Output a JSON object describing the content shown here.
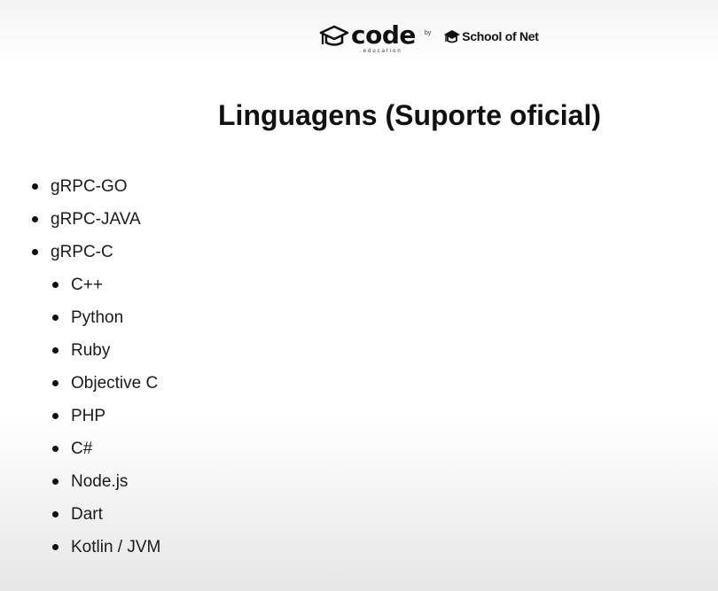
{
  "logos": {
    "code_text": "code",
    "code_sub": ".education",
    "by_text": "by",
    "son_text": "School of Net"
  },
  "slide": {
    "title": "Linguagens (Suporte oficial)",
    "items": [
      {
        "label": "gRPC-GO"
      },
      {
        "label": "gRPC-JAVA"
      },
      {
        "label": "gRPC-C",
        "children": [
          {
            "label": "C++"
          },
          {
            "label": "Python"
          },
          {
            "label": "Ruby"
          },
          {
            "label": "Objective C"
          },
          {
            "label": "PHP"
          },
          {
            "label": "C#"
          },
          {
            "label": "Node.js"
          },
          {
            "label": "Dart"
          },
          {
            "label": "Kotlin / JVM"
          }
        ]
      }
    ]
  },
  "icons": {
    "code_logo": "graduation-cap-icon",
    "son_logo": "graduation-cap-icon"
  },
  "colors": {
    "text": "#111111",
    "background": "#ffffff"
  }
}
